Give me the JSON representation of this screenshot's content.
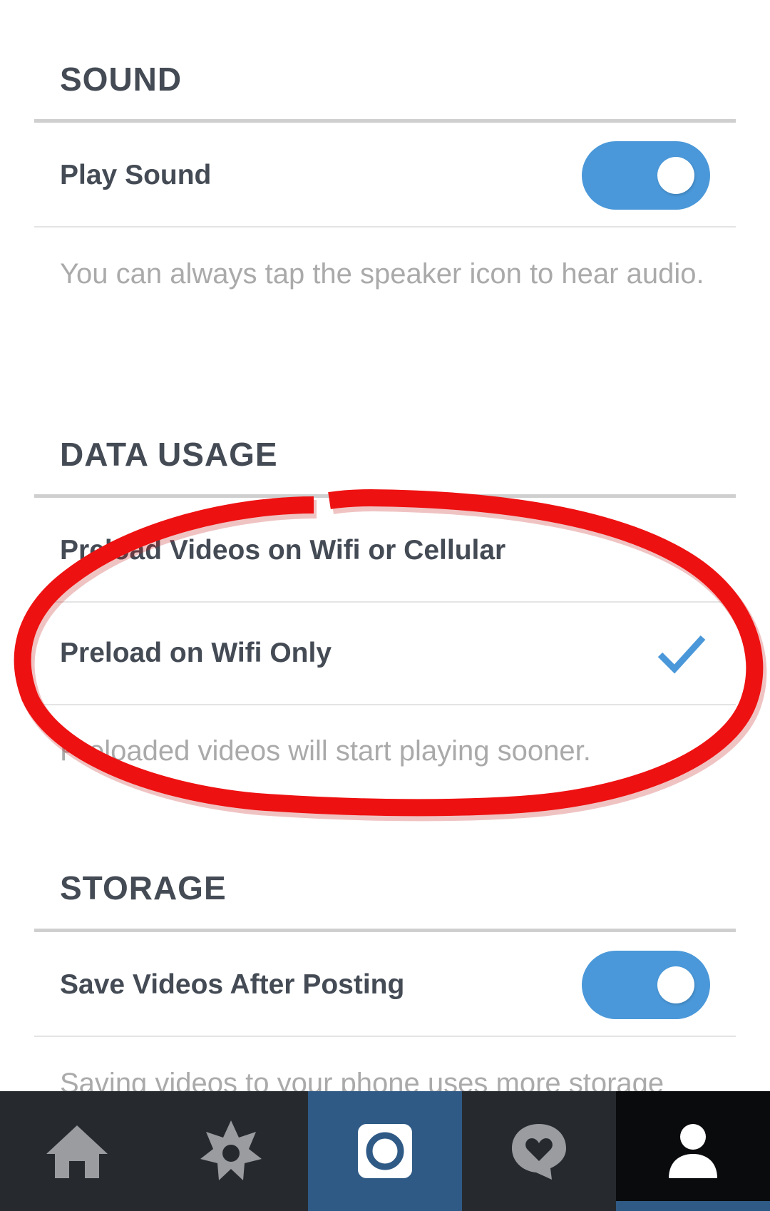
{
  "sound": {
    "header": "SOUND",
    "play_sound_label": "Play Sound",
    "play_sound_on": true,
    "description": "You can always tap the speaker icon to hear audio."
  },
  "data_usage": {
    "header": "DATA USAGE",
    "options": [
      {
        "label": "Preload Videos on Wifi or Cellular",
        "selected": false
      },
      {
        "label": "Preload on Wifi Only",
        "selected": true
      }
    ],
    "description": "Preloaded videos will start playing sooner."
  },
  "storage": {
    "header": "STORAGE",
    "save_videos_label": "Save Videos After Posting",
    "save_videos_on": true,
    "description": "Saving videos to your phone uses more storage"
  },
  "nav": {
    "items": [
      {
        "icon": "home-icon"
      },
      {
        "icon": "explore-icon"
      },
      {
        "icon": "camera-icon"
      },
      {
        "icon": "activity-icon"
      },
      {
        "icon": "profile-icon"
      }
    ],
    "active": "profile-icon"
  },
  "colors": {
    "accent": "#4a98d9",
    "text": "#444b55",
    "muted": "#aaaaaa",
    "annotation": "#ee1111",
    "nav_bg": "#262a2f",
    "camera_bg": "#2f5a85"
  }
}
